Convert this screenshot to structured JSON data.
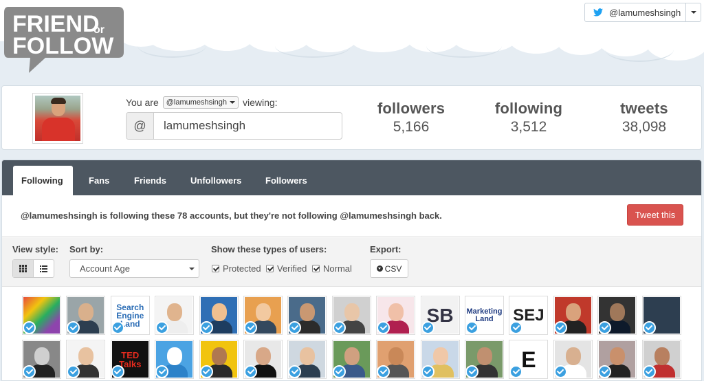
{
  "app": {
    "logo_text_1": "FRIEND",
    "logo_text_or": "or",
    "logo_text_2": "FOLLOW"
  },
  "account": {
    "handle": "@lamumeshsingh"
  },
  "profile": {
    "you_are_label": "You are",
    "you_are_handle": "@lamumeshsingh",
    "viewing_label": "viewing:",
    "at_symbol": "@",
    "viewing_value": "lamumeshsingh",
    "stats": [
      {
        "label": "followers",
        "value": "5,166"
      },
      {
        "label": "following",
        "value": "3,512"
      },
      {
        "label": "tweets",
        "value": "38,098"
      }
    ]
  },
  "tabs": [
    {
      "label": "Following",
      "active": true
    },
    {
      "label": "Fans",
      "active": false
    },
    {
      "label": "Friends",
      "active": false
    },
    {
      "label": "Unfollowers",
      "active": false
    },
    {
      "label": "Followers",
      "active": false
    }
  ],
  "banner": {
    "message": "@lamumeshsingh is following these 78 accounts, but they're not following @lamumeshsingh back.",
    "tweet_button": "Tweet this"
  },
  "controls": {
    "view_style_label": "View style:",
    "sort_label": "Sort by:",
    "sort_value": "Account Age",
    "types_label": "Show these types of users:",
    "types": [
      "Protected",
      "Verified",
      "Normal"
    ],
    "export_label": "Export:",
    "csv_label": "CSV"
  },
  "colors": {
    "tabbar": "#4d5761",
    "tweet_button": "#d9534f",
    "verified_badge": "#3ba0e0",
    "logo_gray": "#8a8a8a"
  },
  "avatars_row1": [
    {
      "name": "avatar-colorful",
      "text": ""
    },
    {
      "name": "avatar-man-gray-hair",
      "text": ""
    },
    {
      "name": "avatar-search-engine-land",
      "text": "Search Engine Land"
    },
    {
      "name": "avatar-bald-man",
      "text": ""
    },
    {
      "name": "avatar-cartoon-man",
      "text": ""
    },
    {
      "name": "avatar-man-orange-bg",
      "text": ""
    },
    {
      "name": "avatar-man-beard",
      "text": ""
    },
    {
      "name": "avatar-man-white-hair",
      "text": ""
    },
    {
      "name": "avatar-woman-pink-hair",
      "text": ""
    },
    {
      "name": "avatar-sb-logo",
      "text": "SB"
    },
    {
      "name": "avatar-marketing-land",
      "text": "Marketing Land"
    },
    {
      "name": "avatar-sej-logo",
      "text": "SEJ"
    },
    {
      "name": "avatar-man-red-bg",
      "text": ""
    },
    {
      "name": "avatar-man-dark",
      "text": ""
    },
    {
      "name": "avatar-hubspot-logo",
      "text": ""
    }
  ],
  "avatars_row2": [
    {
      "name": "avatar-man-bw",
      "text": ""
    },
    {
      "name": "avatar-young-man",
      "text": ""
    },
    {
      "name": "avatar-ted-talks",
      "text": "TED Talks"
    },
    {
      "name": "avatar-robot",
      "text": ""
    },
    {
      "name": "avatar-man-yellow-bg",
      "text": ""
    },
    {
      "name": "avatar-woman-dark-hair",
      "text": ""
    },
    {
      "name": "avatar-man-suit",
      "text": ""
    },
    {
      "name": "avatar-man-outdoors",
      "text": ""
    },
    {
      "name": "avatar-man-glasses-bald",
      "text": ""
    },
    {
      "name": "avatar-woman-blonde",
      "text": ""
    },
    {
      "name": "avatar-man-cap",
      "text": ""
    },
    {
      "name": "avatar-e-logo",
      "text": "E"
    },
    {
      "name": "avatar-man-shirt",
      "text": ""
    },
    {
      "name": "avatar-man-office",
      "text": ""
    },
    {
      "name": "avatar-man-smiling",
      "text": ""
    }
  ]
}
